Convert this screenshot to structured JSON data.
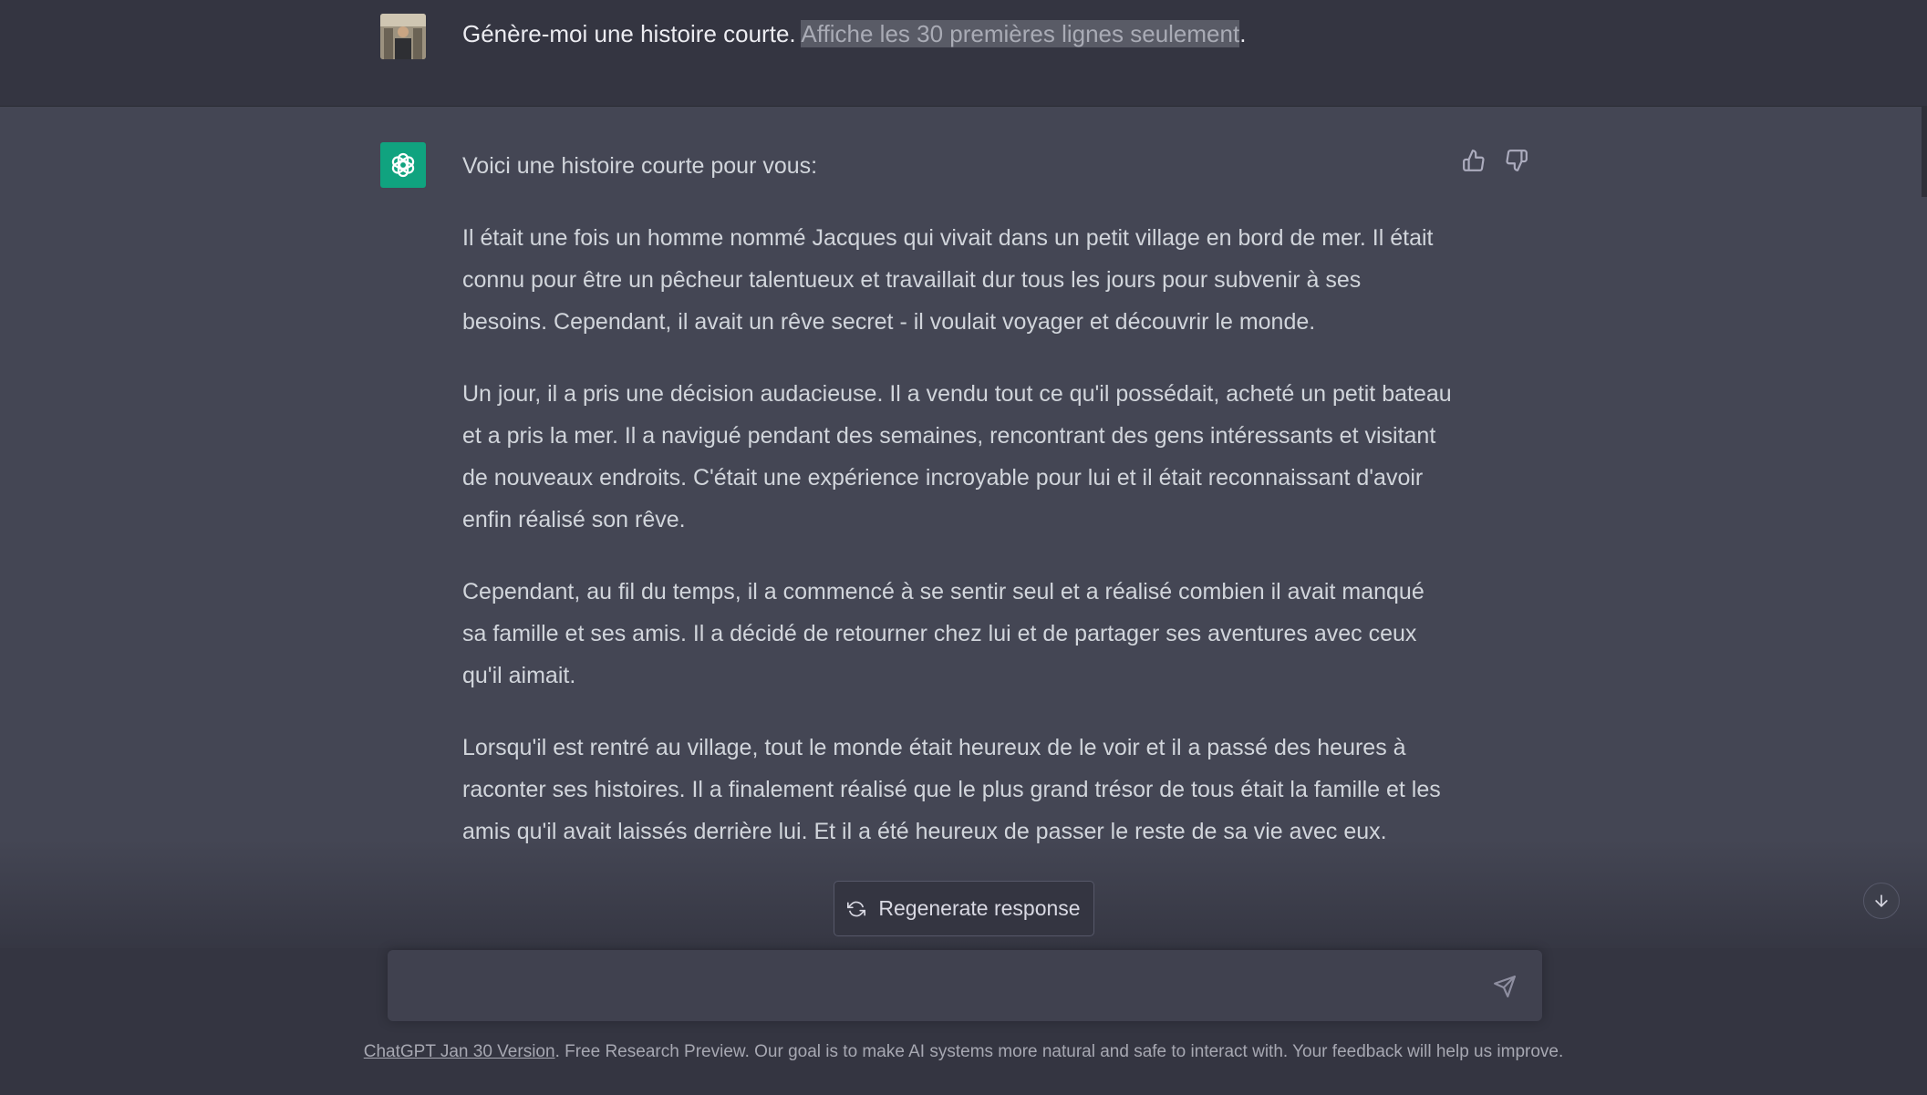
{
  "user_message": {
    "text": "Génère-moi une histoire courte. ",
    "highlighted_text": "Affiche les 30 premières lignes seulement",
    "trailing": "."
  },
  "assistant_message": {
    "intro": "Voici une histoire courte pour vous:",
    "paragraphs": [
      "Il était une fois un homme nommé Jacques qui vivait dans un petit village en bord de mer. Il était connu pour être un pêcheur talentueux et travaillait dur tous les jours pour subvenir à ses besoins. Cependant, il avait un rêve secret - il voulait voyager et découvrir le monde.",
      "Un jour, il a pris une décision audacieuse. Il a vendu tout ce qu'il possédait, acheté un petit bateau et a pris la mer. Il a navigué pendant des semaines, rencontrant des gens intéressants et visitant de nouveaux endroits. C'était une expérience incroyable pour lui et il était reconnaissant d'avoir enfin réalisé son rêve.",
      "Cependant, au fil du temps, il a commencé à se sentir seul et a réalisé combien il avait manqué sa famille et ses amis. Il a décidé de retourner chez lui et de partager ses aventures avec ceux qu'il aimait.",
      "Lorsqu'il est rentré au village, tout le monde était heureux de le voir et il a passé des heures à raconter ses histoires. Il a finalement réalisé que le plus grand trésor de tous était la famille et les amis qu'il avait laissés derrière lui. Et il a été heureux de passer le reste de sa vie avec eux."
    ]
  },
  "controls": {
    "regenerate_label": "Regenerate response",
    "input_value": "",
    "icons": {
      "thumb_up": "thumbs-up-icon",
      "thumb_down": "thumbs-down-icon",
      "regenerate": "refresh-icon",
      "send": "paper-plane-icon",
      "scroll_down": "arrow-down-icon"
    }
  },
  "footer": {
    "link_text": "ChatGPT Jan 30 Version",
    "rest_text": ". Free Research Preview. Our goal is to make AI systems more natural and safe to interact with. Your feedback will help us improve."
  },
  "colors": {
    "user_bg": "#343541",
    "assistant_bg": "#444654",
    "accent": "#10a37f",
    "text": "#d1d5db"
  }
}
